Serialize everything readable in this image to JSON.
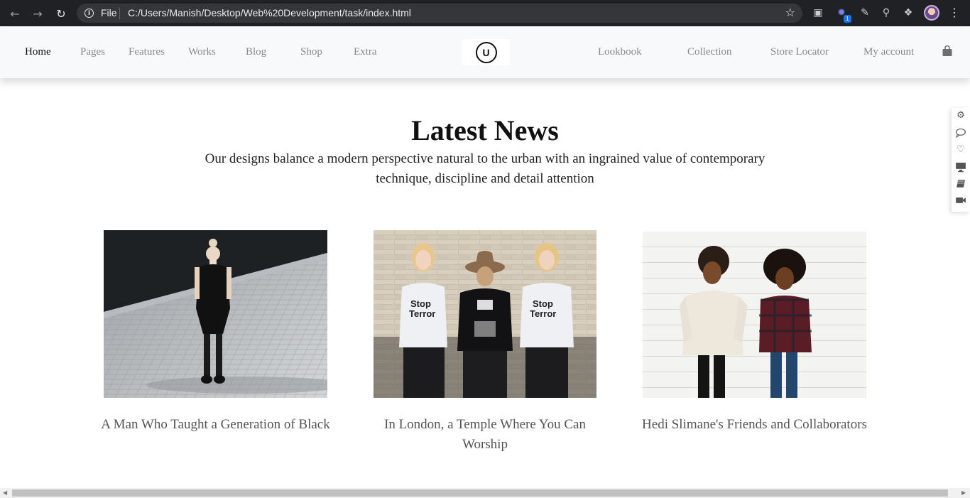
{
  "browser": {
    "scheme_label": "File",
    "url": "C:/Users/Manish/Desktop/Web%20Development/task/index.html",
    "extension_badge": "1"
  },
  "nav": {
    "left_items": [
      "Home",
      "Pages",
      "Features",
      "Works",
      "Blog",
      "Shop",
      "Extra"
    ],
    "logo_letter": "U",
    "right_items": [
      "Lookbook",
      "Collection",
      "Store Locator",
      "My account"
    ]
  },
  "section": {
    "title": "Latest News",
    "subtitle_line1": "Our designs balance a modern perspective natural to the urban with an ingrained value of contemporary",
    "subtitle_line2": "technique, discipline and detail attention"
  },
  "cards": [
    {
      "title": "A Man Who Taught a Generation of Black",
      "image": "woman in black dress standing on paved plaza"
    },
    {
      "title_line1": "In London, a Temple Where You Can",
      "title_line2": "Worship",
      "image": "three women in printed t-shirts against brick wall"
    },
    {
      "title": "Hedi Slimane's Friends and Collaborators",
      "image": "two laughing women against white wall"
    }
  ],
  "side_tools": [
    "gear-icon",
    "comment-icon",
    "heart-icon",
    "monitor-icon",
    "book-icon",
    "video-icon"
  ]
}
